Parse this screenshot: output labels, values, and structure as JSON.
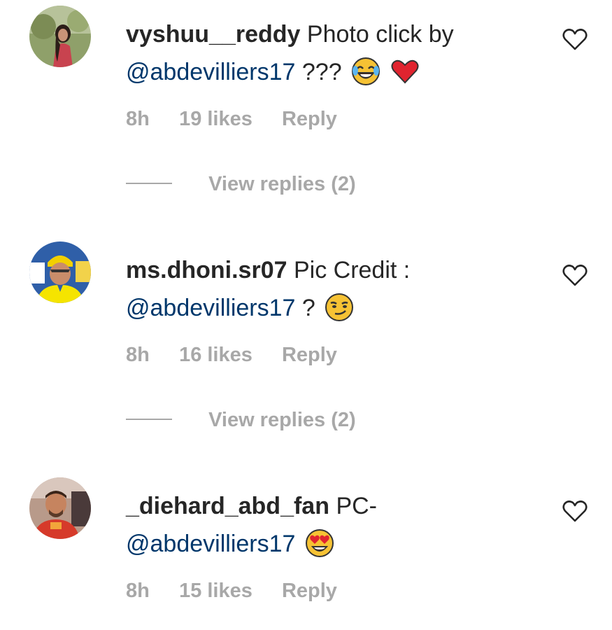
{
  "comments": [
    {
      "username": "vyshuu__reddy",
      "text": "Photo click by",
      "mention": "@abdevilliers17",
      "suffix": "???",
      "emojis": [
        "face-with-tears-of-joy-emoji",
        "red-heart-emoji"
      ],
      "time": "8h",
      "likes": "19 likes",
      "reply_label": "Reply",
      "view_replies": "View replies (2)",
      "avatar_icon": "user-avatar-photo"
    },
    {
      "username": "ms.dhoni.sr07",
      "text": "Pic Credit :",
      "mention": "@abdevilliers17",
      "suffix": "?",
      "emojis": [
        "smirking-face-emoji"
      ],
      "time": "8h",
      "likes": "16 likes",
      "reply_label": "Reply",
      "view_replies": "View replies (2)",
      "avatar_icon": "user-avatar-photo"
    },
    {
      "username": "_diehard_abd_fan",
      "text": "PC-",
      "mention": "@abdevilliers17",
      "suffix": "",
      "emojis": [
        "heart-eyes-emoji"
      ],
      "time": "8h",
      "likes": "15 likes",
      "reply_label": "Reply",
      "avatar_icon": "user-avatar-photo"
    }
  ],
  "colors": {
    "text": "#262626",
    "mention": "#00376b",
    "secondary": "#a8a8a8"
  }
}
